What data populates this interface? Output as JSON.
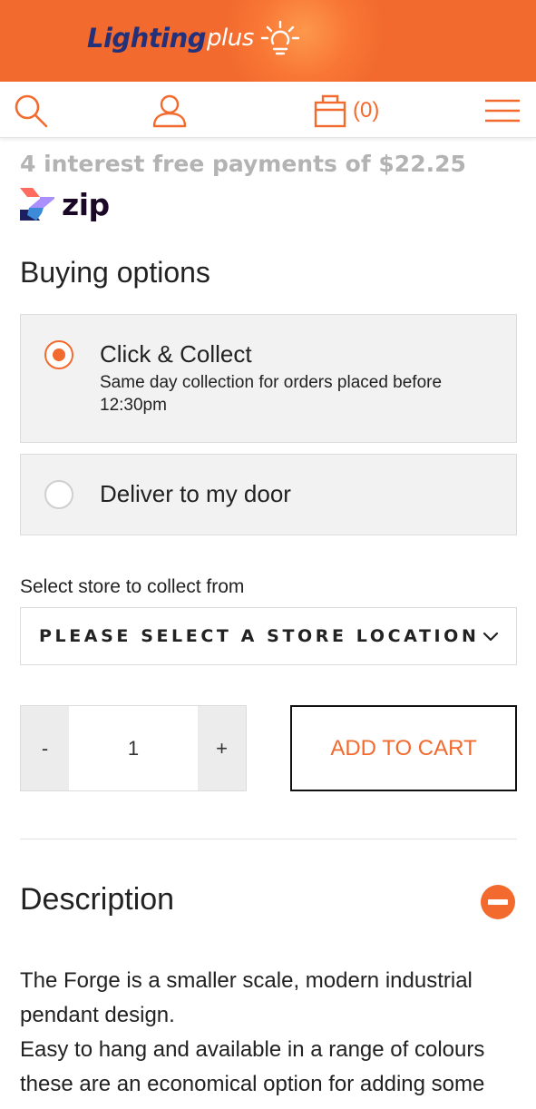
{
  "header": {
    "logo_primary": "Lighting",
    "logo_secondary": "plus",
    "brand_color": "#f26a2e",
    "logo_color": "#23307a"
  },
  "nav": {
    "cart_count": "(0)",
    "icons": [
      "search-icon",
      "account-icon",
      "cart-icon",
      "menu-icon"
    ]
  },
  "payment": {
    "interest_text": "4 interest free payments of $22.25",
    "zip_label": "zip"
  },
  "buying_options": {
    "title": "Buying options",
    "options": [
      {
        "label": "Click & Collect",
        "sub": "Same day collection for orders placed before 12:30pm",
        "selected": true
      },
      {
        "label": "Deliver to my door",
        "sub": "",
        "selected": false
      }
    ]
  },
  "store": {
    "label": "Select store to collect from",
    "selected": "PLEASE SELECT A STORE LOCATION"
  },
  "quantity": {
    "minus": "-",
    "value": "1",
    "plus": "+"
  },
  "actions": {
    "add_to_cart": "ADD TO CART"
  },
  "description": {
    "title": "Description",
    "paragraphs": [
      "The Forge is a smaller scale, modern industrial pendant design.",
      "Easy to hang and available in a range of colours these are an economical option for adding some flair to your home."
    ]
  }
}
